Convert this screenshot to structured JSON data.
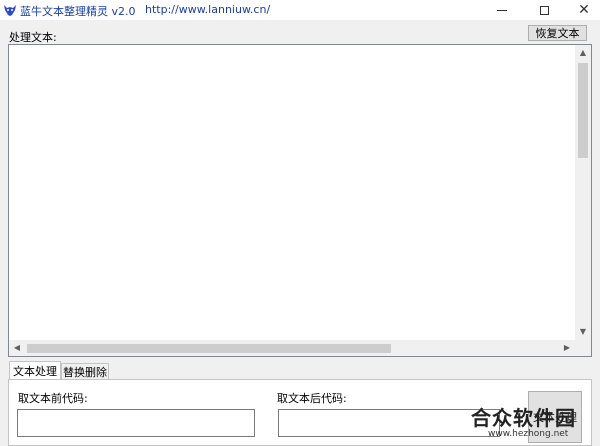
{
  "window": {
    "title": "蓝牛文本整理精灵 v2.0",
    "url": "http://www.lanniuw.cn/",
    "icon": "blue-ox-logo",
    "controls": [
      "minimize",
      "maximize",
      "close"
    ]
  },
  "main": {
    "process_label": "处理文本:",
    "restore_button": "恢复文本",
    "text_content": ""
  },
  "tabs": [
    {
      "label": "文本处理",
      "active": true
    },
    {
      "label": "替换删除",
      "active": false
    }
  ],
  "panel": {
    "before_code_label": "取文本前代码:",
    "after_code_label": "取文本后代码:",
    "before_code_value": "",
    "after_code_value": "",
    "action_button": "文本处理"
  },
  "watermark": {
    "text": "合众软件园",
    "sub": "www.hezhong.net"
  }
}
